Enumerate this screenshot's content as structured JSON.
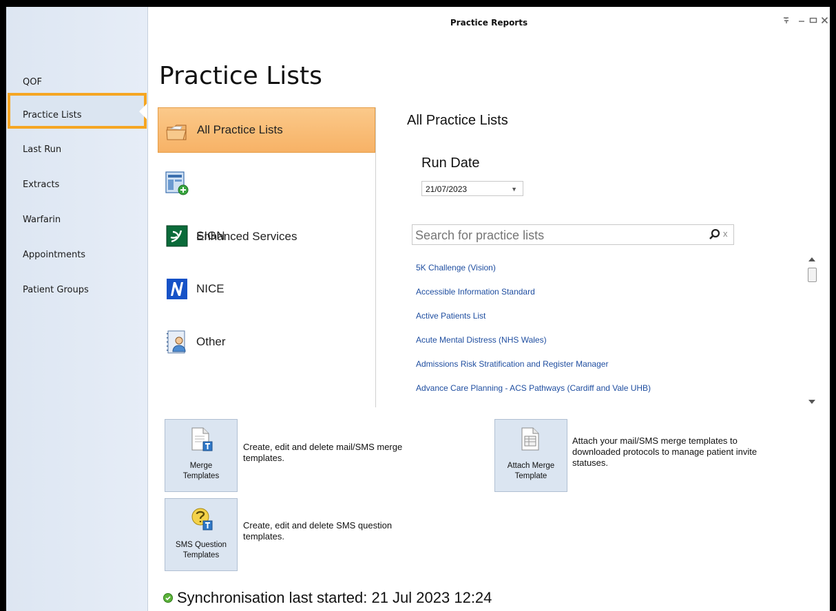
{
  "window": {
    "title": "Practice Reports",
    "controls": {
      "help": "?",
      "minimize": "–",
      "maximize": "□",
      "close": "X"
    }
  },
  "sidebar": {
    "items": [
      {
        "label": "QOF"
      },
      {
        "label": "Practice Lists",
        "selected": true
      },
      {
        "label": "Last Run"
      },
      {
        "label": "Extracts"
      },
      {
        "label": "Warfarin"
      },
      {
        "label": "Appointments"
      },
      {
        "label": "Patient Groups"
      }
    ]
  },
  "page": {
    "title": "Practice Lists"
  },
  "categories": [
    {
      "label": "All Practice Lists",
      "icon": "folder-icon",
      "selected": true
    },
    {
      "label": "Enhanced Services",
      "icon": "enhanced-services-icon"
    },
    {
      "label": "SIGN",
      "icon": "sign-icon"
    },
    {
      "label": "NICE",
      "icon": "nice-icon"
    },
    {
      "label": "Other",
      "icon": "other-user-icon"
    }
  ],
  "details": {
    "heading": "All Practice Lists",
    "run_date_label": "Run Date",
    "run_date_value": "21/07/2023",
    "search_placeholder": "Search for practice lists",
    "search_clear": "x",
    "lists": [
      "5K Challenge (Vision)",
      "Accessible Information Standard",
      "Active Patients List",
      "Acute Mental Distress (NHS Wales)",
      "Admissions Risk Stratification and Register Manager",
      "Advance Care Planning - ACS Pathways (Cardiff and Vale UHB)"
    ]
  },
  "tiles": {
    "merge_templates": {
      "label_line1": "Merge",
      "label_line2": "Templates",
      "desc_line1": "Create, edit and delete mail/SMS merge",
      "desc_line2": "templates."
    },
    "attach_merge_template": {
      "label_line1": "Attach Merge",
      "label_line2": "Template",
      "desc_line1": "Attach your mail/SMS merge templates to",
      "desc_line2": "downloaded protocols to manage patient invite",
      "desc_line3": "statuses."
    },
    "sms_question_templates": {
      "label_line1": "SMS Question",
      "label_line2": "Templates",
      "desc_line1": "Create, edit and delete SMS question",
      "desc_line2": "templates."
    }
  },
  "sync": {
    "text": "Synchronisation last started: 21 Jul 2023 12:24",
    "status": "ok"
  },
  "colors": {
    "accent": "#f5a623",
    "sidebar_bg": "#dde6f2",
    "link": "#1f4ea0",
    "tile_bg": "#dbe5f1"
  }
}
